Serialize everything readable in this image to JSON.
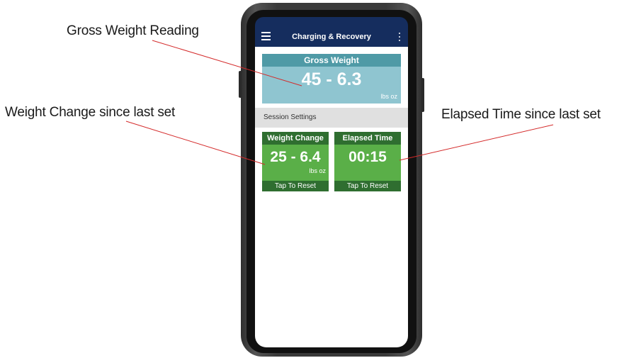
{
  "annotations": {
    "gross_weight_reading": "Gross Weight Reading",
    "weight_change": "Weight Change since last set",
    "elapsed_time": "Elapsed Time since last set"
  },
  "app_bar": {
    "title": "Charging & Recovery",
    "menu_icon": "hamburger-menu-icon",
    "more_icon": "more-vertical-icon",
    "color": "#152d5e"
  },
  "gross_weight": {
    "header": "Gross Weight",
    "value": "45 - 6.3",
    "units": "lbs oz"
  },
  "session_settings": {
    "label": "Session Settings"
  },
  "weight_change": {
    "header": "Weight Change",
    "value": "25 - 6.4",
    "units": "lbs oz",
    "action": "Tap To Reset"
  },
  "elapsed_time": {
    "header": "Elapsed Time",
    "value": "00:15",
    "action": "Tap To Reset"
  },
  "colors": {
    "gross_header": "#4f9aa6",
    "gross_body": "#8fc5d0",
    "tile_header": "#2f6e30",
    "tile_body": "#5aaf48"
  }
}
